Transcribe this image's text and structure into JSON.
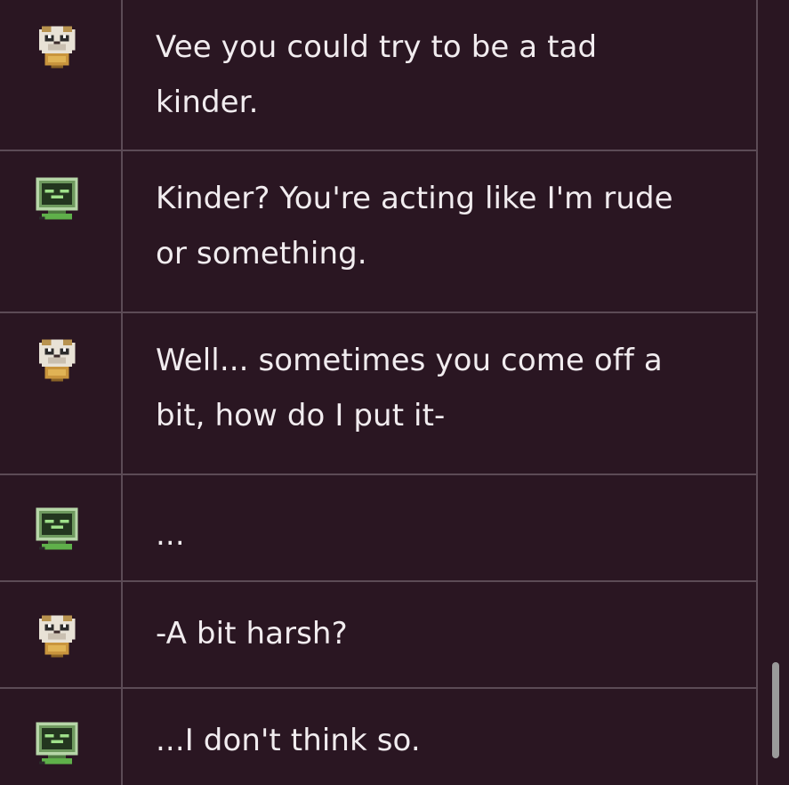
{
  "messages": [
    {
      "speaker": "dog",
      "text": "Vee you could try to be a tad\nkinder."
    },
    {
      "speaker": "vee",
      "text": "Kinder? You're acting like I'm rude\nor something."
    },
    {
      "speaker": "dog",
      "text": "Well... sometimes you come off a\nbit, how do I put it-"
    },
    {
      "speaker": "vee",
      "text": "..."
    },
    {
      "speaker": "dog",
      "text": "-A bit harsh?"
    },
    {
      "speaker": "vee",
      "text": "...I don't think so."
    }
  ],
  "icons": {
    "dog": "dog-avatar-icon",
    "vee": "monitor-avatar-icon"
  },
  "colors": {
    "background": "#2a1622",
    "border": "#5c4b56",
    "text": "#f1ecef",
    "scrollbar": "#9a9a9a"
  }
}
